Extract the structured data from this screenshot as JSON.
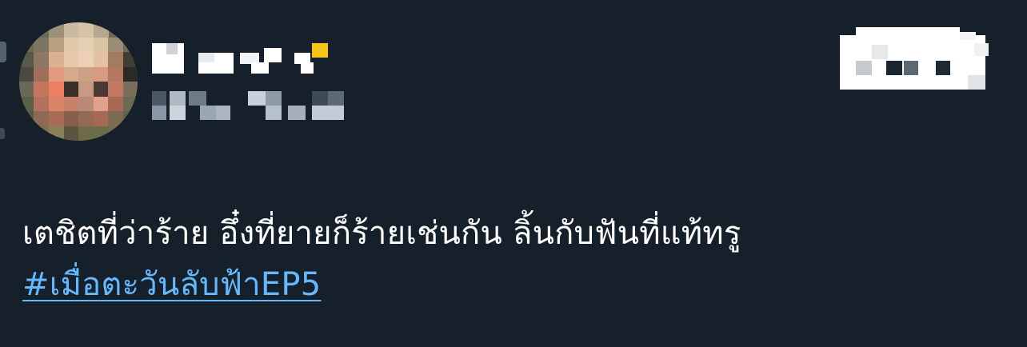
{
  "tweet": {
    "author": {
      "avatar_state": "pixelated",
      "name_state": "pixelated",
      "handle_state": "pixelated"
    },
    "follow_button_state": "pixelated",
    "text": "เตชิตที่ว่าร้าย อึ๋งที่ยายก็ร้ายเช่นกัน ลิ้นกับฟันที่แท้ทรู",
    "hashtag": "#เมื่อตะวันลับฟ้าEP5"
  },
  "colors": {
    "background": "#15202b",
    "text": "#ffffff",
    "hashtag": "#64b8ff",
    "name_accent": "#f5c518"
  },
  "icons": [
    "thread-line-mark"
  ]
}
